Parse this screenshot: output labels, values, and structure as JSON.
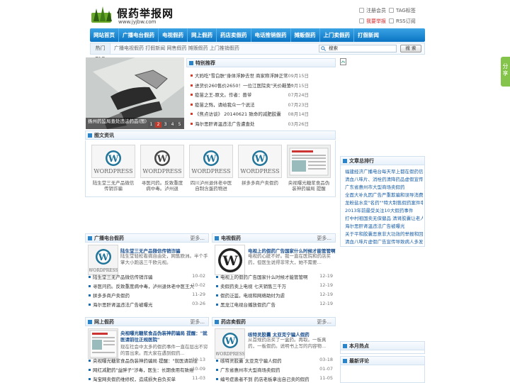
{
  "header": {
    "logo_name": "假药举报网",
    "logo_url": "www.jyjbw.com",
    "links": [
      "注册会员",
      "TAG标签",
      "我要举报",
      "RSS订阅"
    ]
  },
  "nav": [
    "网站首页",
    "广播电台假药",
    "电视假药",
    "网上假药",
    "药店卖假药",
    "电话推销假药",
    "摊贩假药",
    "上门卖假药",
    "打假新闻"
  ],
  "tagbar": {
    "label": "热门TAG",
    "tags": "广播电视假药 打假新闻 网售假药 摊贩假药 上门推销假药",
    "search_value": "搜索",
    "search_button": "搜 索"
  },
  "slider": {
    "caption": "扬州药监局查处违法药品(图)",
    "pages": [
      "1",
      "2",
      "3",
      "4",
      "5"
    ]
  },
  "recommend": {
    "title": "特别推荐",
    "items": [
      {
        "t": "大妈吃\"雪白肤\"身体浮肿去世 商家称浮肿正常",
        "d": "09月15日"
      },
      {
        "t": "进货价260售价2650！一位江医院卖\"天价鞋垫\"",
        "d": "09月15日"
      },
      {
        "t": "疫苗之王-原文。作者：兽爷",
        "d": "07月24日"
      },
      {
        "t": "疫苗之殇，请给我众一个说法",
        "d": "07月23日"
      },
      {
        "t": "《焦点访谈》 20140621 致命的减肥胶囊",
        "d": "08月14日"
      },
      {
        "t": "海尔思肝肾温违法广告遭查处",
        "d": "03月26日"
      }
    ]
  },
  "image_news": {
    "title": "图文资讯",
    "items": [
      "陆生堂三无产品微信传销诈骗",
      "寻医问药。反致重度病中毒。泸州退",
      "四川泸州退休老中医自制含蛋药物进",
      "拼多多商户卖假药",
      "央视曝光糖浆食品伪装神药骗局 提醒"
    ]
  },
  "article_rank": {
    "title": "文章总排行",
    "items": [
      "福建经济广播电台每天早上都在假药信",
      "清血八味片、消栓药清降药品虚假宣传",
      "广东省惠州市大型商场卖假药",
      "全面大补丸因广告严重欺骗和误导消费",
      "龙粉盐水变\"名药\"\"特大制售假药案件审",
      "2013年前最受关注10大假药事件",
      "打中村祖国卖无保健品 清肾胶囊让老人",
      "海尔思肝肾温违法广告被曝光",
      "关于平和胶囊恶意非大功效的举报和回",
      "清血八味片虚假广告宣传导致病人多发"
    ]
  },
  "month_hot": {
    "title": "本月热点"
  },
  "latest_comments": {
    "title": "最新评论"
  },
  "share": "分享",
  "sections": {
    "radio": {
      "title": "广播电台假药",
      "more": "更多...",
      "lead_title": "陆生堂三无产品微信传销诈骗",
      "lead_summary": "陆生堂轻松看病自由处，网售欧洲。半个手掌大小跑选三千欧元视。",
      "items": [
        {
          "t": "陆生堂三无产品微信传销诈骗",
          "d": "10-02"
        },
        {
          "t": "寻医问药。反致重度病中毒，泸州退休老中医王大",
          "d": "10-02"
        },
        {
          "t": "拼多多商户卖假药",
          "d": "11-29"
        },
        {
          "t": "海尔思肝肾温违法广告被曝光",
          "d": "03-26"
        }
      ]
    },
    "tv": {
      "title": "电视假药",
      "more": "更多...",
      "lead_title": "电视上的假药广告国家什么时候才能管管啊",
      "lead_summary": "电视药心脏不好。我一直在医院和药店买药，但医生说得非常大，她不需要…",
      "items": [
        {
          "t": "电视上的假药广告国家什么时候才能管管啊",
          "d": "12-19"
        },
        {
          "t": "卖假药卖上电视 七天销售三千万",
          "d": "12-19"
        },
        {
          "t": "假药泛滥，电视和网络助纣为虐",
          "d": "12-19"
        },
        {
          "t": "黑龙江电视台播放假药广告",
          "d": "12-19"
        }
      ]
    },
    "online": {
      "title": "网上假药",
      "more": "更多...",
      "lead_title": "央视曝光糖浆食品伪装神药骗局 提醒：\"就医请前往正规医院\"",
      "lead_summary": "现在社会中太多的假药事件一直在层出不穷的冒出来。而大家在遇到假药...",
      "items": [
        {
          "t": "央视曝光糖浆食品伪装神药骗局 提醒：\"就医请前往",
          "d": "10-13"
        },
        {
          "t": "网红减肥药\"益胖子\"涉毒，医生：长期食用有致癌",
          "d": "10-09"
        },
        {
          "t": "淘宝网卖假药维修权，造成损失自负买单",
          "d": "11-03"
        }
      ]
    },
    "pharmacy": {
      "title": "药店卖假药",
      "more": "更多...",
      "lead_title": "咳特灵胶囊 太亚克宁骗人假药",
      "lead_summary": "从首规药店买了一盒药。再取。一板真药，一板假药。说明书上写的内容物...",
      "items": [
        {
          "t": "咳特灵胶囊 太亚克宁骗人假药",
          "d": "03-18"
        },
        {
          "t": "广东省惠州市大型商场卖假药",
          "d": "01-07"
        },
        {
          "t": "编号症患者不到 药店老板拿出自己卖的假药",
          "d": "11-05"
        }
      ]
    }
  }
}
